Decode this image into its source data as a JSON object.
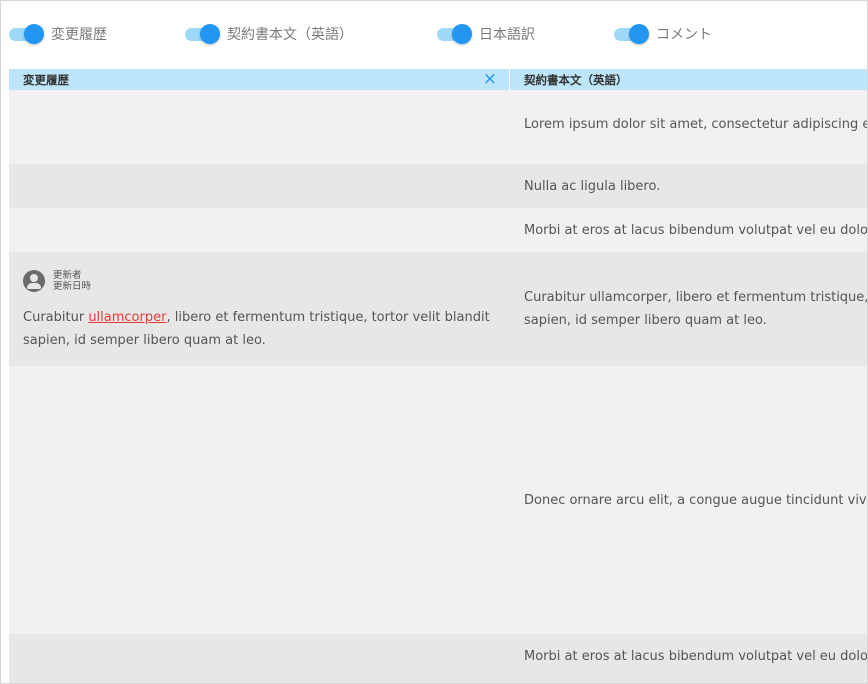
{
  "toggles": [
    {
      "label": "変更履歴",
      "on": true
    },
    {
      "label": "契約書本文（英語）",
      "on": true
    },
    {
      "label": "日本語訳",
      "on": true
    },
    {
      "label": "コメント",
      "on": true
    }
  ],
  "columns": {
    "history": {
      "title": "変更履歴",
      "close_icon": "×"
    },
    "english": {
      "title": "契約書本文（英語）"
    }
  },
  "rows": [
    {
      "text": "Lorem ipsum dolor sit amet, consectetur adipiscing elit."
    },
    {
      "text": "Nulla ac ligula libero."
    },
    {
      "text": "Morbi at eros at lacus bibendum volutpat vel eu dolor."
    },
    {
      "text_line1": "Curabitur ullamcorper, libero et fermentum tristique, tortor velit blandit",
      "text_line2": "sapien, id semper libero quam at leo."
    },
    {
      "text": "Donec ornare arcu elit, a congue augue tincidunt viverra."
    },
    {
      "text": "Morbi at eros at lacus bibendum volutpat vel eu dolor."
    }
  ],
  "history_entry": {
    "author_label": "更新者",
    "date_label": "更新日時",
    "text_before": "Curabitur ",
    "changed_word": "ullamcorper",
    "text_after": ", libero et fermentum tristique, tortor velit blandit sapien, id semper libero quam at leo."
  },
  "colors": {
    "accent": "#2196f3",
    "header_bg": "#bde6fa",
    "change_highlight": "#e53935"
  }
}
